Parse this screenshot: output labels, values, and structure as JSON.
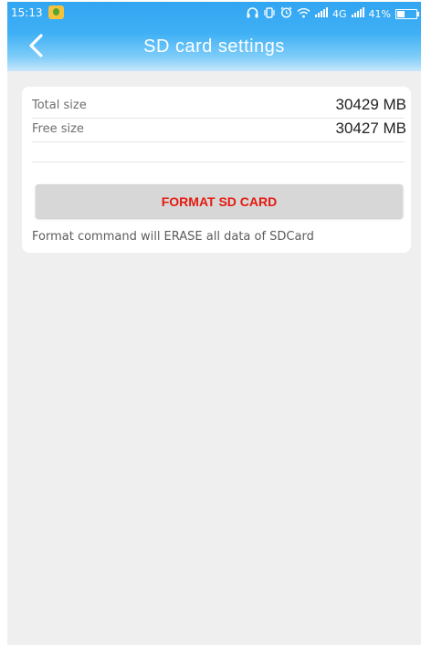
{
  "status_bar": {
    "time": "15:13",
    "signal_4g": "4G",
    "battery_percent": "41%",
    "battery_level": 0.41
  },
  "header": {
    "title": "SD card settings",
    "back_icon": "chevron-left-icon"
  },
  "storage": {
    "total_label": "Total size",
    "total_value": "30429 MB",
    "free_label": "Free size",
    "free_value": "30427 MB"
  },
  "format": {
    "button_label": "FORMAT SD CARD",
    "note": "Format command will ERASE all data of SDCard",
    "button_text_color": "#e5190f"
  },
  "colors": {
    "header_accent": "#3fb0f5",
    "background": "#efefef"
  }
}
